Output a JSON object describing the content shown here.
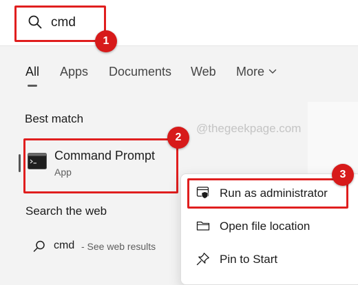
{
  "search": {
    "query": "cmd"
  },
  "tabs": [
    {
      "label": "All"
    },
    {
      "label": "Apps"
    },
    {
      "label": "Documents"
    },
    {
      "label": "Web"
    },
    {
      "label": "More"
    }
  ],
  "best_match": {
    "heading": "Best match",
    "app_name": "Command Prompt",
    "app_type": "App"
  },
  "watermark": "@thegeekpage.com",
  "web_search": {
    "heading": "Search the web",
    "query": "cmd",
    "suffix": "- See web results"
  },
  "context_menu": {
    "items": [
      {
        "label": "Run as administrator",
        "icon": "shield-icon"
      },
      {
        "label": "Open file location",
        "icon": "folder-icon"
      },
      {
        "label": "Pin to Start",
        "icon": "pin-icon"
      }
    ]
  },
  "annotations": {
    "badges": [
      "1",
      "2",
      "3"
    ],
    "highlight_color": "#e01e1e"
  },
  "colors": {
    "background": "#f3f3f3",
    "badge": "#d71a1a"
  }
}
